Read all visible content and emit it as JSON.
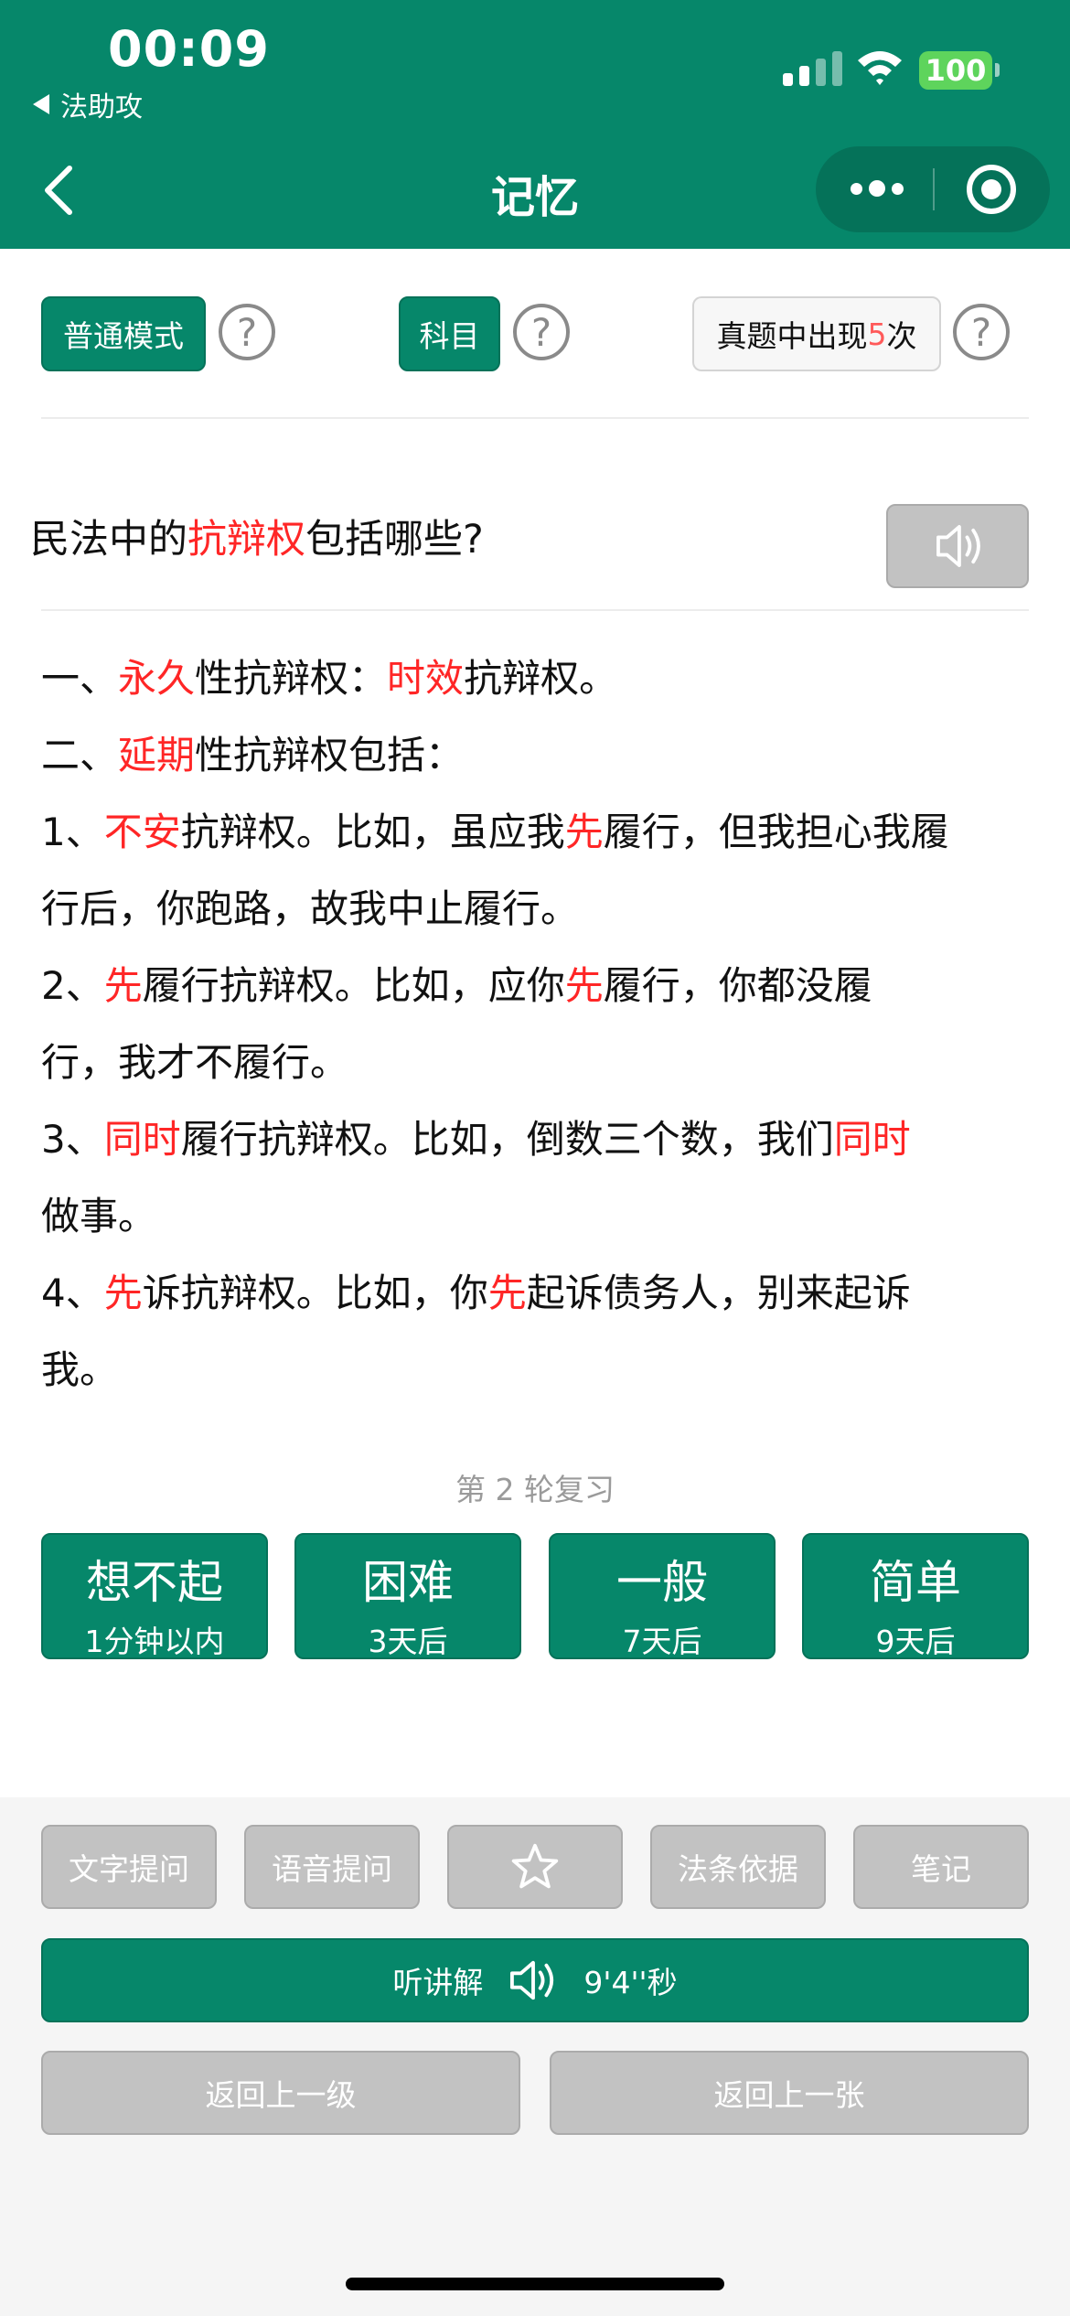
{
  "status_bar": {
    "time": "00:09",
    "back_app": "法助攻",
    "battery": "100"
  },
  "nav": {
    "title": "记忆"
  },
  "mode_row": {
    "mode_label": "普通模式",
    "subject_label": "科目",
    "freq_prefix": "真题中出现",
    "freq_count": "5",
    "freq_suffix": "次",
    "help_glyph": "?"
  },
  "question": {
    "pre": "民法中的",
    "highlight": "抗辩权",
    "post": "包括哪些?"
  },
  "answer": {
    "l1_a": "一、",
    "l1_b": "永久",
    "l1_c": "性抗辩权：",
    "l1_d": "时效",
    "l1_e": "抗辩权。",
    "l2_a": "二、",
    "l2_b": "延期",
    "l2_c": "性抗辩权包括：",
    "l3_a": "1、",
    "l3_b": "不安",
    "l3_c": "抗辩权。比如，虽应我",
    "l3_d": "先",
    "l3_e": "履行，但我担心我履",
    "l4": "行后，你跑路，故我中止履行。",
    "l5_a": "2、",
    "l5_b": "先",
    "l5_c": "履行抗辩权。比如，应你",
    "l5_d": "先",
    "l5_e": "履行，你都没履",
    "l6": "行，我才不履行。",
    "l7_a": "3、",
    "l7_b": "同时",
    "l7_c": "履行抗辩权。比如，倒数三个数，我们",
    "l7_d": "同时",
    "l8": "做事。",
    "l9_a": "4、",
    "l9_b": "先",
    "l9_c": "诉抗辩权。比如，你",
    "l9_d": "先",
    "l9_e": "起诉债务人，别来起诉",
    "l10": "我。"
  },
  "review": {
    "round_text": "第 2 轮复习"
  },
  "rating_buttons": [
    {
      "title": "想不起",
      "sub": "1分钟以内"
    },
    {
      "title": "困难",
      "sub": "3天后"
    },
    {
      "title": "一般",
      "sub": "7天后"
    },
    {
      "title": "简单",
      "sub": "9天后"
    }
  ],
  "tools": {
    "text_ask": "文字提问",
    "voice_ask": "语音提问",
    "law_basis": "法条依据",
    "notes": "笔记",
    "star_icon": "star-icon"
  },
  "listen": {
    "label": "听讲解",
    "duration": "9'4''秒",
    "icon": "speaker-icon"
  },
  "nav_buttons": {
    "back_level": "返回上一级",
    "back_card": "返回上一张"
  },
  "colors": {
    "primary": "#06876a",
    "highlight": "#ff2626",
    "gray_button": "#c2c2c2"
  }
}
